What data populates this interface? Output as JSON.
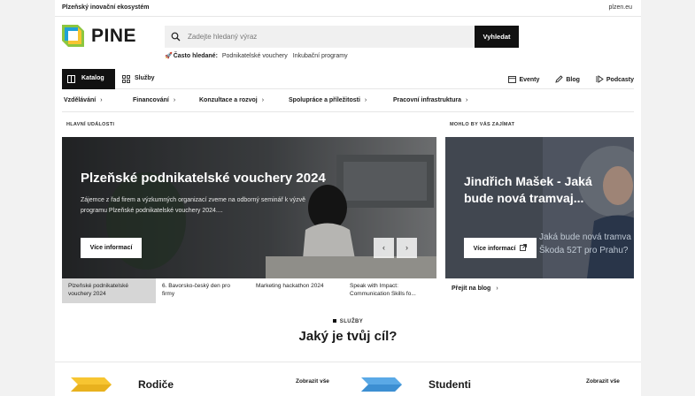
{
  "topbar": {
    "title": "Plzeňský inovační ekosystém",
    "link": "plzen.eu"
  },
  "brand": {
    "name": "PINE"
  },
  "search": {
    "placeholder": "Zadejte hledaný výraz",
    "button": "Vyhledat"
  },
  "frequent": {
    "emoji": "🚀",
    "label": "Často hledané:",
    "links": [
      "Podnikatelské vouchery",
      "Inkubační programy"
    ]
  },
  "nav": {
    "catalog": "Katalog",
    "services": "Služby",
    "right": [
      "Eventy",
      "Blog",
      "Podcasty"
    ]
  },
  "categories": [
    "Vzdělávání",
    "Financování",
    "Konzultace a rozvoj",
    "Spolupráce a příležitosti",
    "Pracovní infrastruktura"
  ],
  "main_events": {
    "heading": "HLAVNÍ UDÁLOSTI",
    "title": "Plzeňské podnikatelské vouchery 2024",
    "text": "Zájemce z řad firem a výzkumných organizací zveme na odborný seminář k výzvě programu Plzeňské podnikatelské vouchery 2024....",
    "more": "Více informací",
    "prev": "‹",
    "next": "›",
    "strip": [
      "Plzeňské podnikatelské vouchery 2024",
      "6. Bavorsko-český den pro firmy",
      "Marketing hackathon 2024",
      "Speak with Impact: Communication Skills fo..."
    ]
  },
  "interest": {
    "heading": "MOHLO BY VÁS ZAJÍMAT",
    "title": "Jindřich Mašek - Jaká bude nová tramvaj...",
    "bg_text": [
      "Jaká bude nová tramva",
      "Škoda 52T pro Prahu?"
    ],
    "more": "Více informací",
    "blog": "Přejít na blog"
  },
  "services": {
    "tag": "SLUŽBY",
    "title": "Jaký je tvůj cíl?",
    "cards": [
      {
        "title": "Rodiče",
        "all": "Zobrazit vše",
        "color": "#f7c531"
      },
      {
        "title": "Studenti",
        "all": "Zobrazit vše",
        "color": "#5aa9e6"
      }
    ]
  },
  "colors": {
    "dark": "#111111",
    "logo_green": "#8cc63f",
    "logo_blue": "#1fa1d8",
    "logo_yellow": "#f7c531"
  }
}
